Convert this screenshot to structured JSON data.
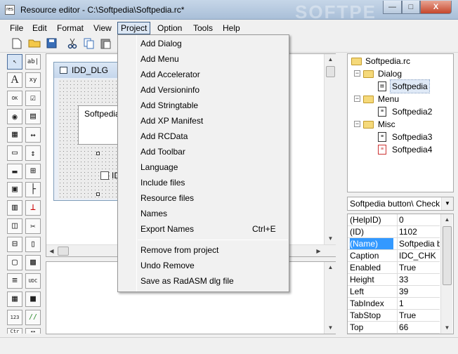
{
  "window": {
    "title": "Resource editor - C:\\Softpedia\\Softpedia.rc*",
    "app_icon_text": "res",
    "minimize": "—",
    "maximize": "□",
    "close": "X",
    "watermark": "SOFTPE"
  },
  "menubar": {
    "items": [
      "File",
      "Edit",
      "Format",
      "View",
      "Project",
      "Option",
      "Tools",
      "Help"
    ]
  },
  "project_menu": {
    "group1": [
      "Add Dialog",
      "Add Menu",
      "Add Accelerator",
      "Add Versioninfo",
      "Add Stringtable",
      "Add XP Manifest",
      "Add RCData",
      "Add Toolbar",
      "Language",
      "Include files",
      "Resource files",
      "Names",
      "Export Names"
    ],
    "export_shortcut": "Ctrl+E",
    "group2": [
      "Remove from project",
      "Undo Remove",
      "Save as RadASM dlg file"
    ]
  },
  "toolbar": {
    "icons": [
      "new-file-icon",
      "open-folder-icon",
      "save-icon",
      "cut-icon",
      "copy-icon",
      "paste-icon"
    ]
  },
  "toolbox": {
    "tools": [
      "↖",
      "ab|",
      "A",
      "xy",
      "OK",
      "☑",
      "◉",
      "▤",
      "▦",
      "↔",
      "▭",
      "↕",
      "▬",
      "⊞",
      "▣",
      "├",
      "▥",
      "⊥",
      "◫",
      "✂",
      "⊟",
      "▯",
      "▢",
      "▩",
      "≡",
      "UDC",
      "▦",
      "■",
      "123",
      "//",
      "Ctr",
      "◂▸"
    ]
  },
  "dialog": {
    "title": "IDD_DLG",
    "groupbox_label": "Softpedia",
    "checkbox_label": "ID"
  },
  "tree": {
    "root": "Softpedia.rc",
    "nodes": [
      "Dialog",
      "Softpedia",
      "Menu",
      "Softpedia2",
      "Misc",
      "Softpedia3",
      "Softpedia4"
    ]
  },
  "combo": {
    "value": "Softpedia button\\ CheckBo"
  },
  "properties": [
    {
      "name": "(HelpID)",
      "value": "0"
    },
    {
      "name": "(ID)",
      "value": "1102"
    },
    {
      "name": "(Name)",
      "value": "Softpedia bu"
    },
    {
      "name": "Caption",
      "value": "IDC_CHK"
    },
    {
      "name": "Enabled",
      "value": "True"
    },
    {
      "name": "Height",
      "value": "33"
    },
    {
      "name": "Left",
      "value": "39"
    },
    {
      "name": "TabIndex",
      "value": "1"
    },
    {
      "name": "TabStop",
      "value": "True"
    },
    {
      "name": "Top",
      "value": "66"
    }
  ]
}
